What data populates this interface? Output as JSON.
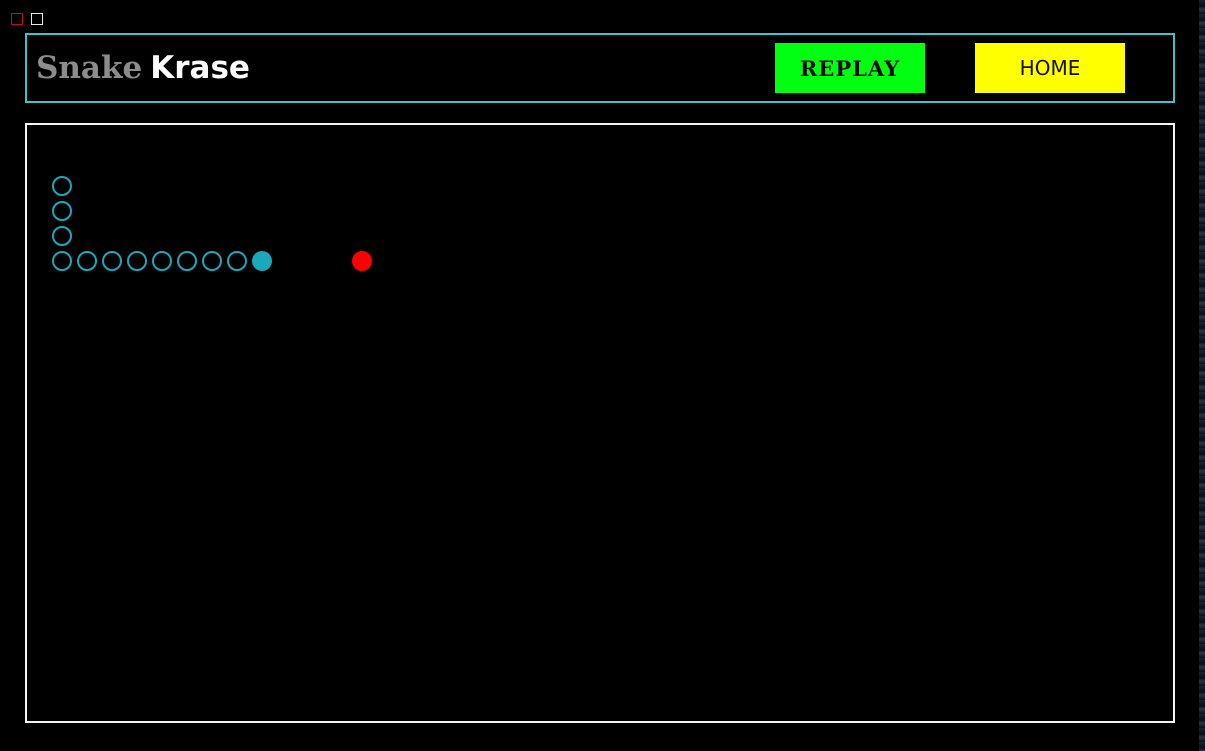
{
  "window": {
    "controls": [
      "close-icon",
      "maximize-icon"
    ],
    "close_color": "#c41010",
    "maximize_color": "#e8e8e8"
  },
  "header": {
    "title_part1": "Snake",
    "title_part2": "Krase",
    "replay_label": "REPLAY",
    "home_label": "HOME",
    "border_color": "#3fc2c9",
    "replay_color": "#00ff10",
    "home_color": "#ffff00"
  },
  "game": {
    "snake_color": "#1aa8bd",
    "food_color": "#ff0000",
    "board_border_color": "#f2f2f2",
    "snake_cells": [
      {
        "col": 0,
        "row": 3,
        "head": false
      },
      {
        "col": 0,
        "row": 4,
        "head": false
      },
      {
        "col": 0,
        "row": 5,
        "head": false
      },
      {
        "col": 0,
        "row": 6,
        "head": false
      },
      {
        "col": 1,
        "row": 6,
        "head": false
      },
      {
        "col": 2,
        "row": 6,
        "head": false
      },
      {
        "col": 3,
        "row": 6,
        "head": false
      },
      {
        "col": 4,
        "row": 6,
        "head": false
      },
      {
        "col": 5,
        "row": 6,
        "head": false
      },
      {
        "col": 6,
        "row": 6,
        "head": false
      },
      {
        "col": 7,
        "row": 6,
        "head": false
      },
      {
        "col": 8,
        "row": 6,
        "head": true
      }
    ],
    "food": {
      "col": 12,
      "row": 6
    }
  }
}
